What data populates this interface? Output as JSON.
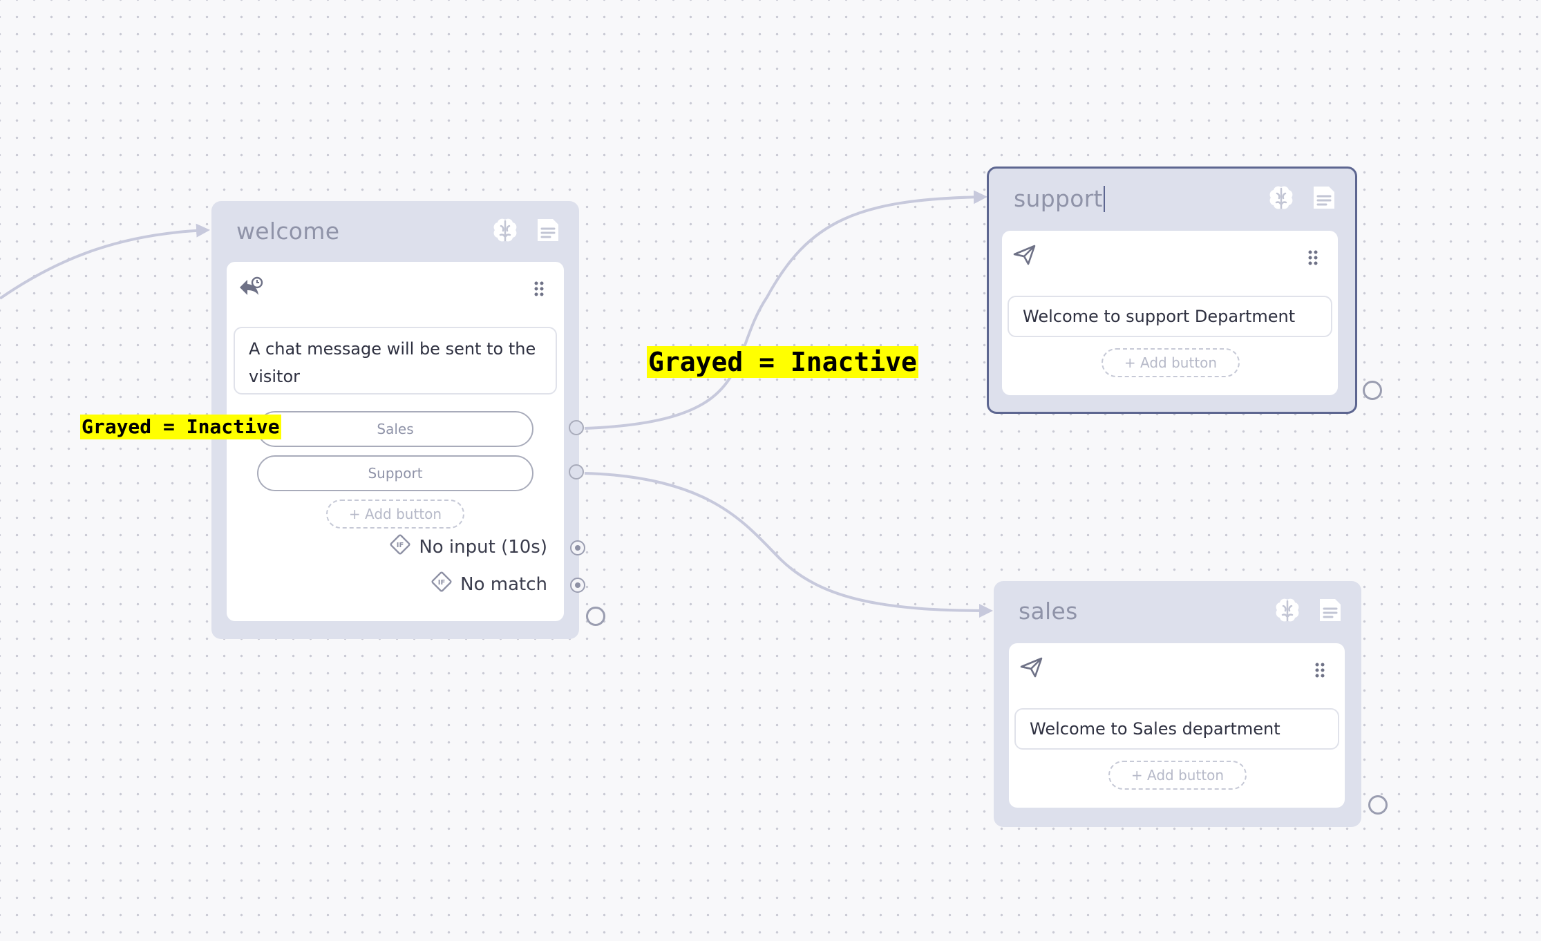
{
  "nodes": {
    "welcome": {
      "title": "welcome",
      "message": "A chat message will be sent to the visitor",
      "buttons": [
        "Sales",
        "Support"
      ],
      "add_button_label": "+ Add button",
      "conditions": [
        "No input (10s)",
        "No match"
      ]
    },
    "support": {
      "title": "support",
      "message": "Welcome to support Department",
      "add_button_label": "+ Add button"
    },
    "sales": {
      "title": "sales",
      "message": "Welcome to Sales department",
      "add_button_label": "+ Add button"
    }
  },
  "annotations": {
    "left": "Grayed = Inactive",
    "center": "Grayed = Inactive"
  },
  "icons": {
    "node_ai": "brain-icon",
    "node_notes": "document-icon",
    "welcome_card": "reply-clock-icon",
    "send_card": "paper-plane-icon",
    "drag": "drag-handle-icon",
    "condition": "if-diamond-icon"
  },
  "colors": {
    "node_bg": "#dde0ec",
    "selected_border": "#5d6690",
    "wire": "#c7c9dc",
    "annotation_bg": "#ffff00",
    "muted_text": "#8f93a8"
  }
}
